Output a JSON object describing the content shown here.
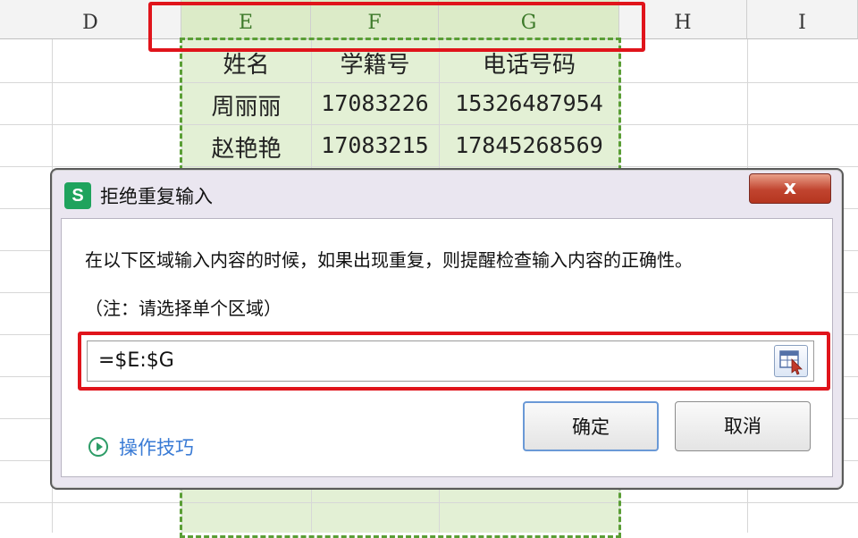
{
  "sheet": {
    "columns": [
      "D",
      "E",
      "F",
      "G",
      "H",
      "I"
    ],
    "rows": [
      [
        "姓名",
        "学籍号",
        "电话号码"
      ],
      [
        "周丽丽",
        "17083226",
        "15326487954"
      ],
      [
        "赵艳艳",
        "17083215",
        "17845268569"
      ]
    ]
  },
  "dialog": {
    "title": "拒绝重复输入",
    "close_label": "x",
    "description": "在以下区域输入内容的时候，如果出现重复，则提醒检查输入内容的正确性。",
    "note": "（注：请选择单个区域）",
    "range_value": "=$E:$G",
    "tips_label": "操作技巧",
    "ok_label": "确定",
    "cancel_label": "取消"
  },
  "colors": {
    "selection": "#e3f0d5",
    "highlight": "#e0141b",
    "marquee": "#5a9e35",
    "app_icon": "#1fa35d"
  }
}
